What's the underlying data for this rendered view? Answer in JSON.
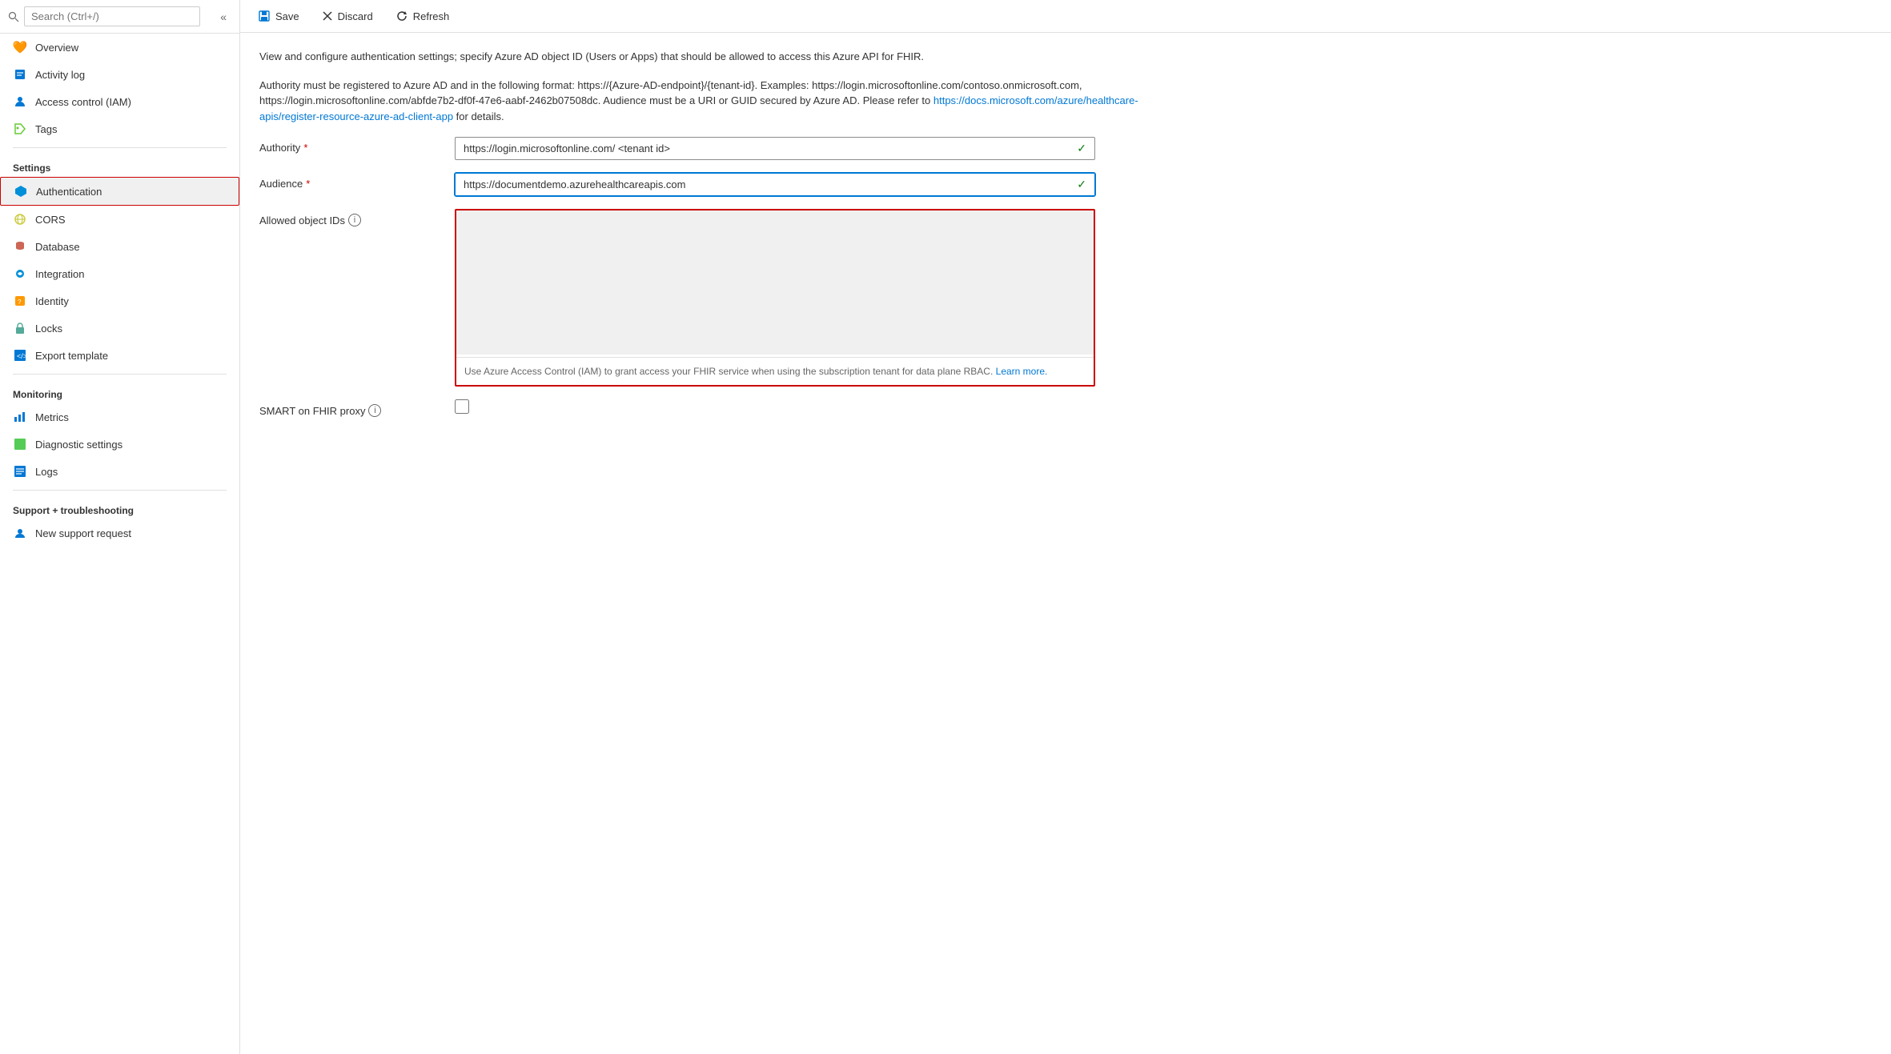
{
  "sidebar": {
    "search_placeholder": "Search (Ctrl+/)",
    "collapse_icon": "«",
    "items": [
      {
        "id": "overview",
        "label": "Overview",
        "icon": "🧡",
        "active": false
      },
      {
        "id": "activity-log",
        "label": "Activity log",
        "icon": "📋",
        "active": false
      },
      {
        "id": "access-control",
        "label": "Access control (IAM)",
        "icon": "👥",
        "active": false
      },
      {
        "id": "tags",
        "label": "Tags",
        "icon": "🏷️",
        "active": false
      }
    ],
    "sections": [
      {
        "label": "Settings",
        "items": [
          {
            "id": "authentication",
            "label": "Authentication",
            "icon": "🔷",
            "active": true
          },
          {
            "id": "cors",
            "label": "CORS",
            "icon": "🌐",
            "active": false
          },
          {
            "id": "database",
            "label": "Database",
            "icon": "🗄️",
            "active": false
          },
          {
            "id": "integration",
            "label": "Integration",
            "icon": "☁️",
            "active": false
          },
          {
            "id": "identity",
            "label": "Identity",
            "icon": "🔑",
            "active": false
          },
          {
            "id": "locks",
            "label": "Locks",
            "icon": "🔒",
            "active": false
          },
          {
            "id": "export-template",
            "label": "Export template",
            "icon": "💻",
            "active": false
          }
        ]
      },
      {
        "label": "Monitoring",
        "items": [
          {
            "id": "metrics",
            "label": "Metrics",
            "icon": "📊",
            "active": false
          },
          {
            "id": "diagnostic-settings",
            "label": "Diagnostic settings",
            "icon": "🟩",
            "active": false
          },
          {
            "id": "logs",
            "label": "Logs",
            "icon": "🖥️",
            "active": false
          }
        ]
      },
      {
        "label": "Support + troubleshooting",
        "items": [
          {
            "id": "new-support-request",
            "label": "New support request",
            "icon": "👤",
            "active": false
          }
        ]
      }
    ]
  },
  "toolbar": {
    "save_label": "Save",
    "discard_label": "Discard",
    "refresh_label": "Refresh"
  },
  "content": {
    "description1": "View and configure authentication settings; specify Azure AD object ID (Users or Apps) that should be allowed to access this Azure API for FHIR.",
    "description2": "Authority must be registered to Azure AD and in the following format: https://{Azure-AD-endpoint}/{tenant-id}. Examples: https://login.microsoftonline.com/contoso.onmicrosoft.com, https://login.microsoftonline.com/abfde7b2-df0f-47e6-aabf-2462b07508dc. Audience must be a URI or GUID secured by Azure AD. Please refer to ",
    "description_link_text": "https://docs.microsoft.com/azure/healthcare-apis/register-resource-azure-ad-client-app",
    "description_link_href": "#",
    "description3": " for details.",
    "authority_label": "Authority",
    "authority_value": "https://login.microsoftonline.com/ <tenant id>",
    "audience_label": "Audience",
    "audience_value": "https://documentdemo.azurehealthcareapis.com",
    "allowed_object_ids_label": "Allowed object IDs",
    "allowed_object_ids_info": "ⓘ",
    "textarea_hint": "Use Azure Access Control (IAM) to grant access your FHIR service when using the subscription tenant for data plane RBAC. ",
    "learn_more_text": "Learn more.",
    "smart_proxy_label": "SMART on FHIR proxy",
    "smart_proxy_info": "ⓘ"
  }
}
